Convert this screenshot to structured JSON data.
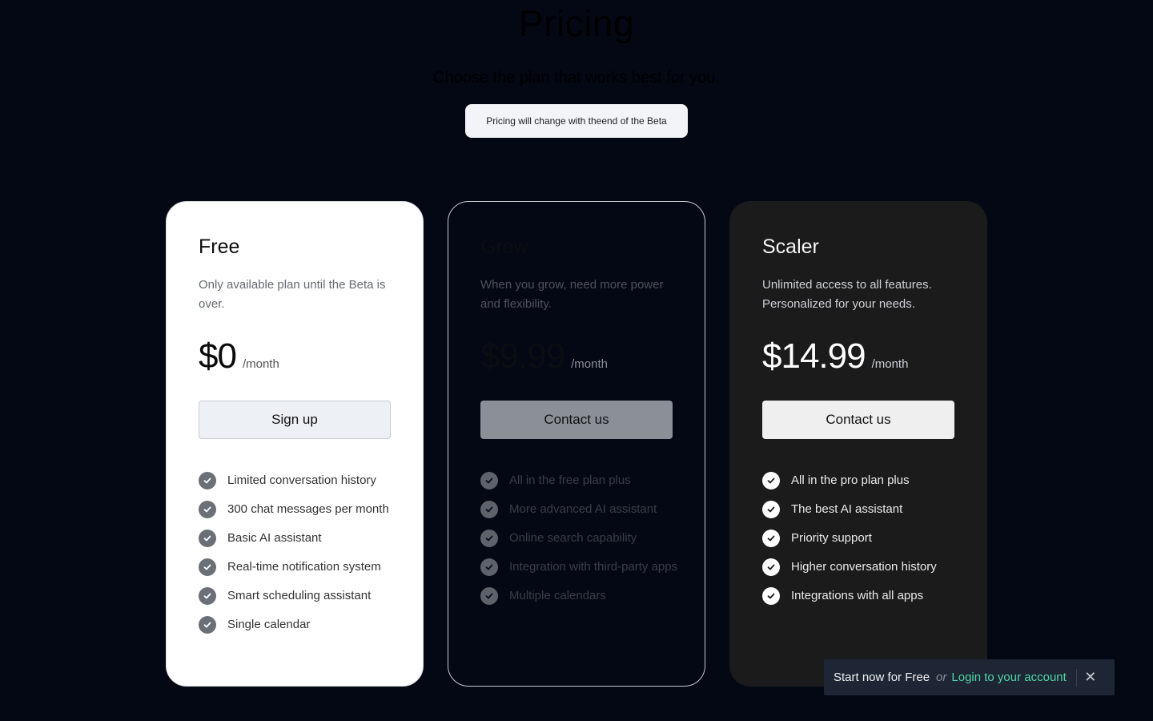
{
  "header": {
    "title": "Pricing",
    "subtitle": "Choose the plan that works best for you.",
    "notice": "Pricing will change with theend of the Beta"
  },
  "plans": [
    {
      "name": "Free",
      "description": "Only available plan until the Beta is over.",
      "price": "$0",
      "period": "/month",
      "cta": "Sign up",
      "features": [
        "Limited conversation history",
        "300 chat messages per month",
        "Basic AI assistant",
        "Real-time notification system",
        "Smart scheduling assistant",
        "Single calendar"
      ]
    },
    {
      "name": "Grow",
      "description": "When you grow, need more power and flexibility.",
      "price": "$9.99",
      "period": "/month",
      "cta": "Contact us",
      "features": [
        "All in the free plan plus",
        "More advanced AI assistant",
        "Online search capability",
        "Integration with third-party apps",
        "Multiple calendars"
      ]
    },
    {
      "name": "Scaler",
      "description": "Unlimited access to all features. Personalized for your needs.",
      "price": "$14.99",
      "period": "/month",
      "cta": "Contact us",
      "features": [
        "All in the pro plan plus",
        "The best AI assistant",
        "Priority support",
        "Higher conversation history",
        "Integrations with all apps"
      ]
    }
  ],
  "toast": {
    "text": "Start now for Free",
    "or": "or",
    "link": "Login to your account",
    "close_icon": "close-icon"
  },
  "icons": {
    "feature_check": "check-circle-icon"
  },
  "colors": {
    "page_background": "#040814",
    "toast_link": "#4fd6a6",
    "scaler_card": "#1b1b1c"
  }
}
